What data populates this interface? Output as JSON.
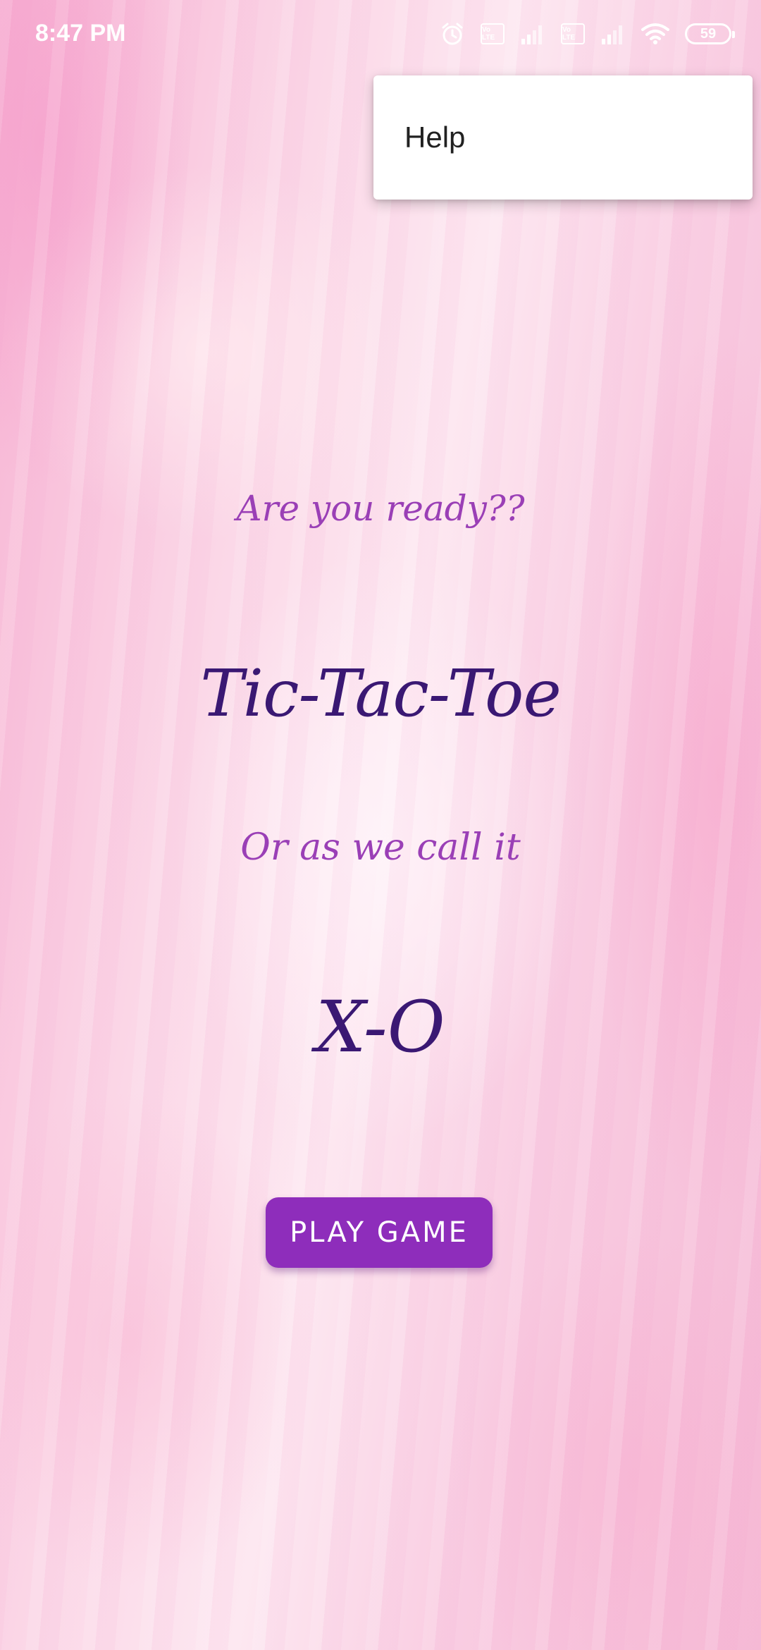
{
  "status_bar": {
    "time": "8:47 PM",
    "battery_level": "59",
    "volte_1": "Vo LTE",
    "volte_2": "Vo LTE",
    "icons": [
      "alarm-icon",
      "volte-icon",
      "signal-icon",
      "volte-icon",
      "signal-icon",
      "wifi-icon",
      "battery-icon"
    ]
  },
  "overflow_menu": {
    "items": [
      {
        "label": "Help"
      }
    ]
  },
  "main": {
    "ready_text": "Are you ready??",
    "title": "Tic-Tac-Toe",
    "subtitle": "Or as we call it",
    "short_name": "X-O",
    "play_button_label": "PLAY GAME"
  },
  "colors": {
    "accent": "#8e2dbb",
    "title_color": "#3a1873",
    "subtitle_color": "#9a3fb6"
  }
}
